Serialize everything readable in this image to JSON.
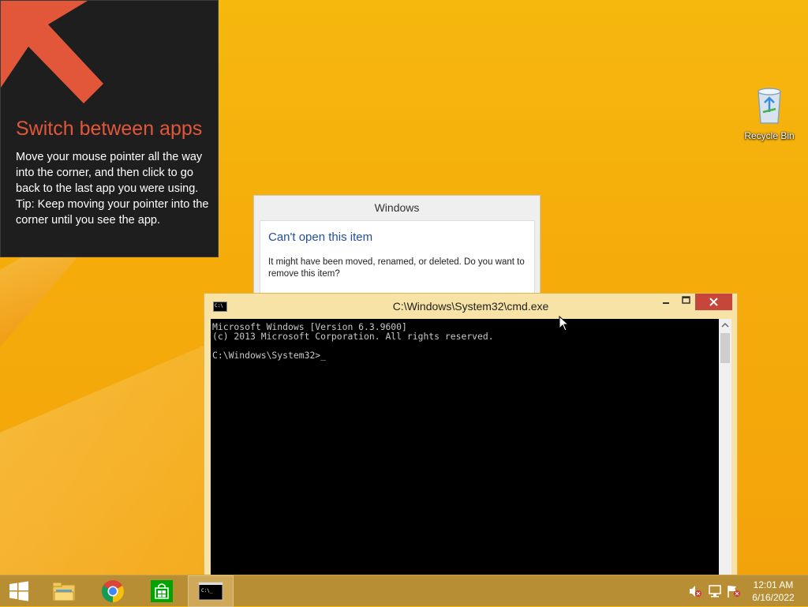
{
  "tip": {
    "title": "Switch between apps",
    "body": "Move your mouse pointer all the way into the corner, and then click to go back to the last app you were using.",
    "tip_text": "Tip: Keep moving your pointer into the corner until you see the app.",
    "accent": "#e2573a"
  },
  "desktop": {
    "recycle_bin_label": "Recycle Bin",
    "background": "#f5ad0b"
  },
  "dialog": {
    "title": "Windows",
    "heading": "Can't open this item",
    "message": "It might have been moved, renamed, or deleted. Do you want to remove this item?"
  },
  "cmd": {
    "title": "C:\\Windows\\System32\\cmd.exe",
    "icon_text": "C:\\",
    "lines": [
      "Microsoft Windows [Version 6.3.9600]",
      "(c) 2013 Microsoft Corporation. All rights reserved.",
      "",
      "C:\\Windows\\System32>_"
    ]
  },
  "taskbar": {
    "items": [
      {
        "name": "start-button",
        "icon": "windows-logo-icon"
      },
      {
        "name": "file-explorer",
        "icon": "folder-icon"
      },
      {
        "name": "chrome",
        "icon": "chrome-icon"
      },
      {
        "name": "store",
        "icon": "store-icon"
      },
      {
        "name": "cmd",
        "icon": "cmd-icon",
        "active": true
      }
    ],
    "tray": {
      "volume_icon": "volume-muted-icon",
      "network_icon": "network-icon",
      "flag_icon": "action-center-icon"
    },
    "clock": {
      "time": "12:01 AM",
      "date": "6/16/2022"
    },
    "color": "#b88e35"
  }
}
